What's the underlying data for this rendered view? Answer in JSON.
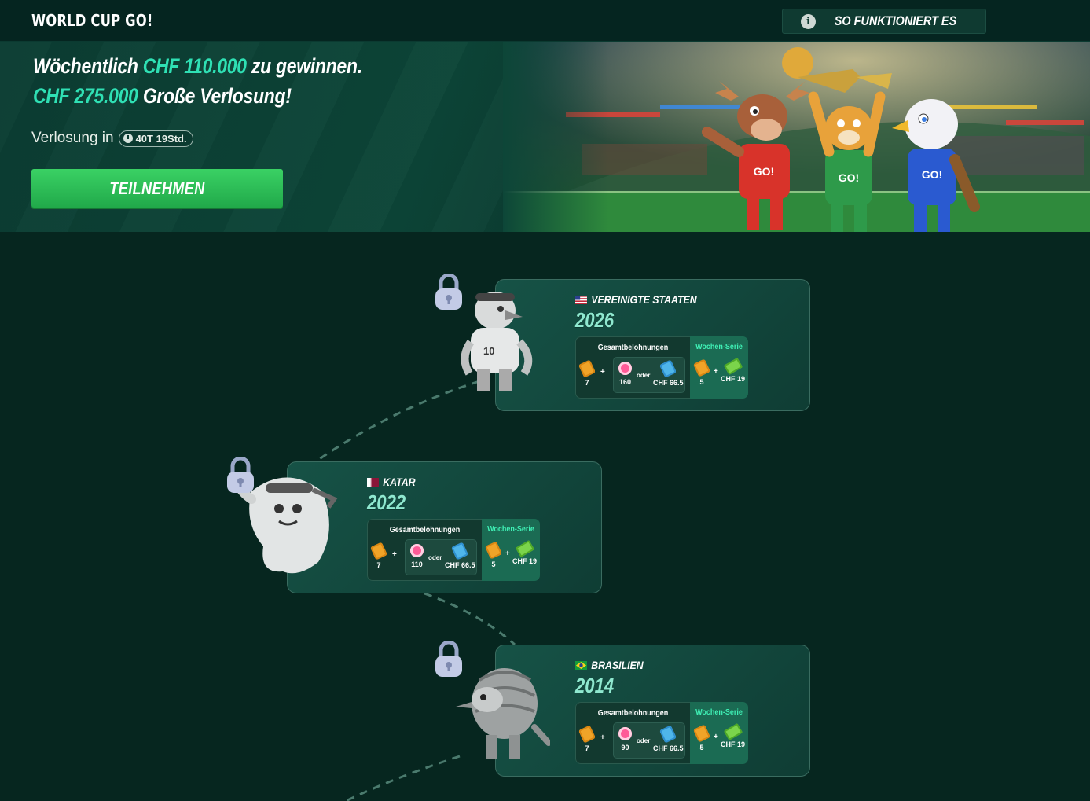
{
  "header": {
    "title": "WORLD CUP GO!",
    "how_it_works": "SO FUNKTIONIERT ES"
  },
  "hero": {
    "line1_pre": "Wöchentlich ",
    "line1_accent": "CHF 110.000",
    "line1_post": " zu gewinnen.",
    "line2_accent": "CHF 275.000",
    "line2_post": " Große Verlosung!",
    "draw_label": "Verlosung in",
    "countdown": "40T 19Std.",
    "join_button": "TEILNEHMEN"
  },
  "labels": {
    "total": "Gesamtbelohnungen",
    "series": "Wochen-Serie",
    "or": "oder",
    "plus": "+"
  },
  "stages": [
    {
      "country": "VEREINIGTE STAATEN",
      "year": "2026",
      "flag": "us",
      "mascot": "eagle",
      "tickets": "7",
      "chips": "160",
      "cash": "CHF 66.5",
      "series_tickets": "5",
      "series_cash": "CHF 19"
    },
    {
      "country": "KATAR",
      "year": "2022",
      "flag": "qa",
      "mascot": "laeeb",
      "tickets": "7",
      "chips": "110",
      "cash": "CHF 66.5",
      "series_tickets": "5",
      "series_cash": "CHF 19"
    },
    {
      "country": "BRASILIEN",
      "year": "2014",
      "flag": "br",
      "mascot": "armadillo",
      "tickets": "7",
      "chips": "90",
      "cash": "CHF 66.5",
      "series_tickets": "5",
      "series_cash": "CHF 19"
    }
  ],
  "colors": {
    "background": "#06261f",
    "accent": "#2fe0b4",
    "join": "#2bbf56",
    "series_header": "#3ff0b5"
  }
}
